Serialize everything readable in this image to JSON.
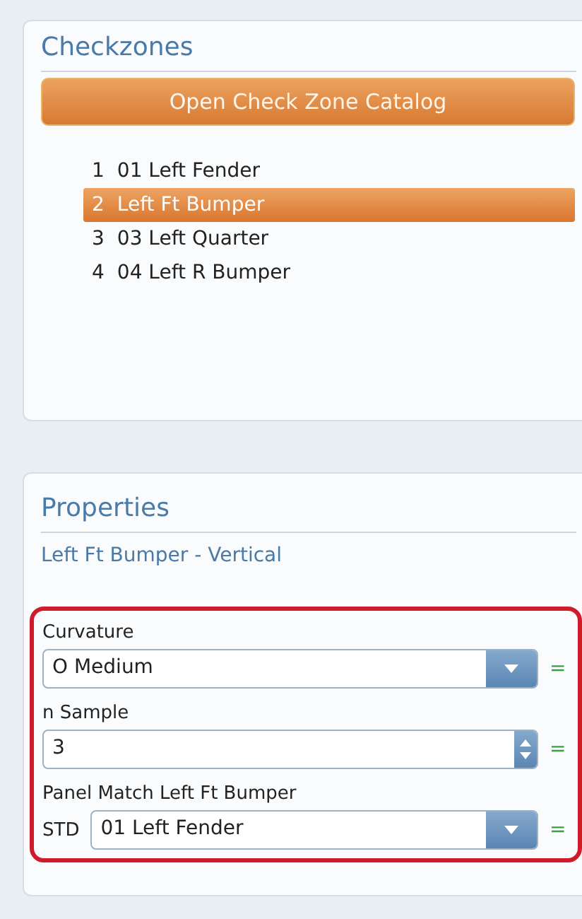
{
  "checkzones": {
    "title": "Checkzones",
    "catalog_button": "Open Check Zone Catalog",
    "items": [
      {
        "index": "1",
        "label": "01 Left Fender",
        "selected": false
      },
      {
        "index": "2",
        "label": "Left Ft Bumper",
        "selected": true
      },
      {
        "index": "3",
        "label": "03 Left Quarter",
        "selected": false
      },
      {
        "index": "4",
        "label": "04 Left R Bumper",
        "selected": false
      }
    ]
  },
  "properties": {
    "title": "Properties",
    "subtitle": "Left Ft Bumper - Vertical",
    "highlighted": true,
    "fields": [
      {
        "kind": "dropdown",
        "label": "Curvature",
        "value": "O Medium",
        "suffix": "="
      },
      {
        "kind": "spinner",
        "label": "n Sample",
        "value": "3",
        "suffix": "="
      },
      {
        "kind": "dropdown",
        "label": "Panel Match Left Ft Bumper",
        "prefix": "STD",
        "value": "01 Left Fender",
        "suffix": "="
      }
    ]
  }
}
